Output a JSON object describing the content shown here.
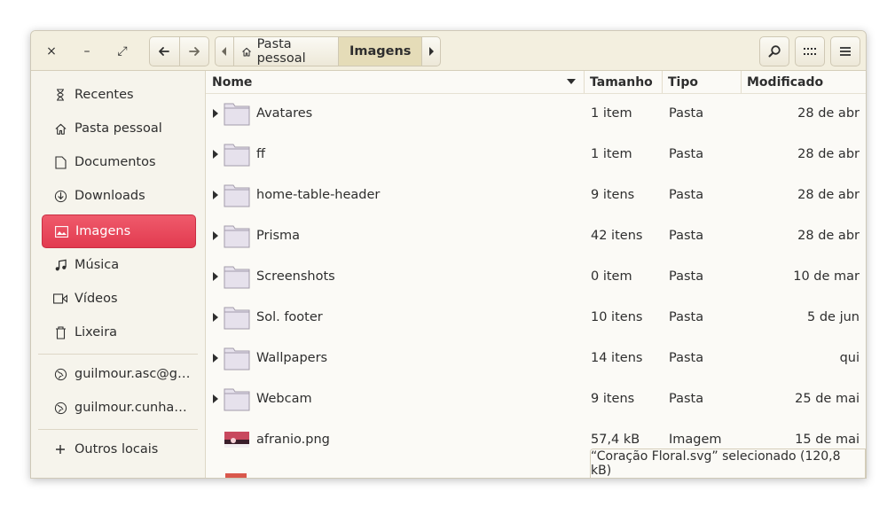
{
  "window_controls": {
    "close": "×",
    "minimize": "–",
    "maximize": "⤢"
  },
  "breadcrumb": {
    "home_label": "Pasta pessoal",
    "current_label": "Imagens"
  },
  "sidebar": {
    "places": [
      {
        "label": "Recentes",
        "icon": "clock-icon"
      },
      {
        "label": "Pasta pessoal",
        "icon": "home-icon"
      },
      {
        "label": "Documentos",
        "icon": "document-icon"
      },
      {
        "label": "Downloads",
        "icon": "download-icon"
      },
      {
        "label": "Imagens",
        "icon": "image-icon",
        "active": true
      },
      {
        "label": "Música",
        "icon": "music-icon"
      },
      {
        "label": "Vídeos",
        "icon": "video-icon"
      },
      {
        "label": "Lixeira",
        "icon": "trash-icon"
      }
    ],
    "network": [
      {
        "label": "guilmour.asc@g…",
        "icon": "globe-icon"
      },
      {
        "label": "guilmour.cunha…",
        "icon": "globe-icon"
      }
    ],
    "other": {
      "label": "Outros locais",
      "icon": "plus-icon"
    }
  },
  "columns": {
    "name": "Nome",
    "size": "Tamanho",
    "type": "Tipo",
    "modified": "Modificado"
  },
  "files": [
    {
      "name": "Avatares",
      "size": "1 item",
      "type": "Pasta",
      "modified": "28 de abr",
      "kind": "folder"
    },
    {
      "name": "ff",
      "size": "1 item",
      "type": "Pasta",
      "modified": "28 de abr",
      "kind": "folder"
    },
    {
      "name": "home-table-header",
      "size": "9 itens",
      "type": "Pasta",
      "modified": "28 de abr",
      "kind": "folder"
    },
    {
      "name": "Prisma",
      "size": "42 itens",
      "type": "Pasta",
      "modified": "28 de abr",
      "kind": "folder"
    },
    {
      "name": "Screenshots",
      "size": "0 item",
      "type": "Pasta",
      "modified": "10 de mar",
      "kind": "folder"
    },
    {
      "name": "Sol. footer",
      "size": "10 itens",
      "type": "Pasta",
      "modified": "5 de jun",
      "kind": "folder"
    },
    {
      "name": "Wallpapers",
      "size": "14 itens",
      "type": "Pasta",
      "modified": "qui",
      "kind": "folder"
    },
    {
      "name": "Webcam",
      "size": "9 itens",
      "type": "Pasta",
      "modified": "25 de mai",
      "kind": "folder"
    },
    {
      "name": "afranio.png",
      "size": "57,4 kB",
      "type": "Imagem",
      "modified": "15 de mai",
      "kind": "image"
    }
  ],
  "status": {
    "text": "“Coração Floral.svg” selecionado  (120,8 kB)"
  },
  "colors": {
    "accent": "#e23b50",
    "headerbar": "#f3efdf",
    "folder": "#e6e1ec"
  }
}
